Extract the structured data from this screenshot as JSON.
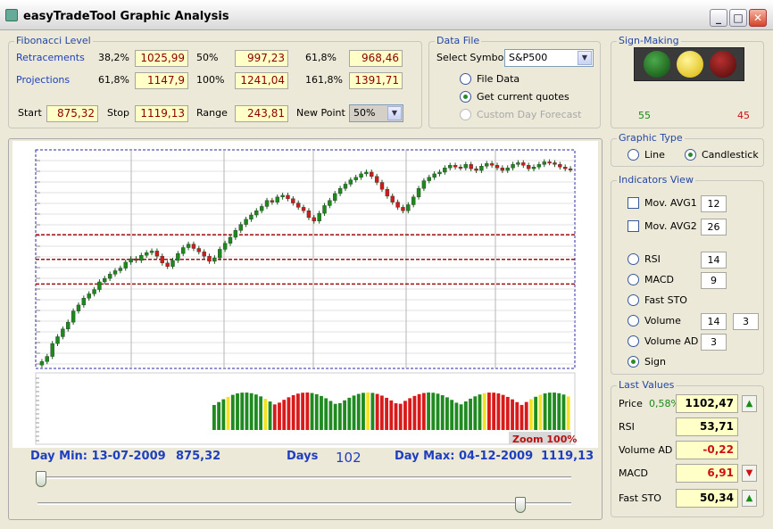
{
  "window": {
    "title": "easyTradeTool Graphic Analysis",
    "buttons": {
      "minimize": "_",
      "maximize": "□",
      "close": "✕"
    }
  },
  "fibonacci": {
    "group_label": "Fibonacci Level",
    "retracements_label": "Retracements",
    "projections_label": "Projections",
    "retr": [
      {
        "pct": "38,2%",
        "val": "1025,99"
      },
      {
        "pct": "50%",
        "val": "997,23"
      },
      {
        "pct": "61,8%",
        "val": "968,46"
      }
    ],
    "proj": [
      {
        "pct": "61,8%",
        "val": "1147,9"
      },
      {
        "pct": "100%",
        "val": "1241,04"
      },
      {
        "pct": "161,8%",
        "val": "1391,71"
      }
    ],
    "start_label": "Start",
    "start_val": "875,32",
    "stop_label": "Stop",
    "stop_val": "1119,13",
    "range_label": "Range",
    "range_val": "243,81",
    "newpoint_label": "New Point",
    "newpoint_val": "50%"
  },
  "datafile": {
    "group_label": "Data File",
    "symbol_label": "Select Symbol",
    "symbol_val": "S&P500",
    "opt_file": "File Data",
    "opt_current": "Get current quotes",
    "opt_custom": "Custom Day Forecast"
  },
  "sign": {
    "group_label": "Sign-Making",
    "left": "55",
    "right": "45",
    "colors": {
      "green": "#1f6b1f",
      "yellow": "#e6cf1c",
      "red": "#7a1010"
    }
  },
  "graphic_type": {
    "group_label": "Graphic Type",
    "line": "Line",
    "candle": "Candlestick"
  },
  "indicators": {
    "group_label": "Indicators View",
    "mov1": "Mov. AVG1",
    "mov1_val": "12",
    "mov2": "Mov. AVG2",
    "mov2_val": "26",
    "rsi": "RSI",
    "rsi_val": "14",
    "macd": "MACD",
    "macd_val": "9",
    "fast": "Fast STO",
    "volume": "Volume",
    "volume_val": "14",
    "volume_val2": "3",
    "volad": "Volume AD",
    "volad_val": "3",
    "sign": "Sign"
  },
  "last_values": {
    "group_label": "Last Values",
    "price_label": "Price",
    "price_pct": "0,58%",
    "price_val": "1102,47",
    "rsi_label": "RSI",
    "rsi_val": "53,71",
    "volad_label": "Volume AD",
    "volad_val": "-0,22",
    "macd_label": "MACD",
    "macd_val": "6,91",
    "fast_label": "Fast STO",
    "fast_val": "50,34",
    "arrows": {
      "up": "▲",
      "down": "▼"
    }
  },
  "chart": {
    "zoom_label": "Zoom 100%",
    "day_min_label": "Day Min: 13-07-2009",
    "day_min_val": "875,32",
    "days_label": "Days",
    "days_val": "102",
    "day_max_label": "Day Max: 04-12-2009",
    "day_max_val": "1119,13"
  },
  "chart_data": {
    "type": "candlestick",
    "close": [
      878,
      884,
      899,
      907,
      916,
      924,
      937,
      944,
      952,
      957,
      962,
      971,
      975,
      980,
      984,
      987,
      994,
      998,
      996,
      1002,
      1005,
      1007,
      1001,
      993,
      989,
      996,
      1004,
      1011,
      1015,
      1010,
      1006,
      1001,
      995,
      999,
      1009,
      1016,
      1023,
      1031,
      1038,
      1044,
      1049,
      1054,
      1059,
      1066,
      1064,
      1070,
      1072,
      1068,
      1063,
      1058,
      1054,
      1046,
      1042,
      1051,
      1060,
      1066,
      1074,
      1080,
      1085,
      1090,
      1093,
      1097,
      1099,
      1094,
      1087,
      1079,
      1071,
      1064,
      1058,
      1054,
      1061,
      1070,
      1080,
      1089,
      1093,
      1097,
      1099,
      1104,
      1107,
      1105,
      1104,
      1108,
      1103,
      1101,
      1106,
      1109,
      1107,
      1104,
      1101,
      1104,
      1108,
      1110,
      1107,
      1103,
      1105,
      1108,
      1111,
      1110,
      1108,
      1105,
      1103,
      1102
    ],
    "volume_colors": [
      "g",
      "g",
      "g",
      "y",
      "g",
      "g",
      "g",
      "g",
      "g",
      "g",
      "g",
      "y",
      "g",
      "r",
      "r",
      "r",
      "r",
      "r",
      "r",
      "r",
      "r",
      "g",
      "g",
      "g",
      "g",
      "g",
      "g",
      "g",
      "g",
      "g",
      "g",
      "g",
      "g",
      "y",
      "g",
      "r",
      "r",
      "r",
      "r",
      "r",
      "r",
      "r",
      "r",
      "r",
      "r",
      "r",
      "g",
      "g",
      "g",
      "g",
      "g",
      "g",
      "g",
      "g",
      "g",
      "g",
      "g",
      "g",
      "y",
      "r",
      "r",
      "r",
      "r",
      "r",
      "r",
      "r",
      "r",
      "r",
      "y",
      "g",
      "y",
      "g",
      "g",
      "g",
      "g",
      "g",
      "y"
    ],
    "fib_levels": [
      1025.99,
      997.23,
      968.46
    ],
    "ylim": [
      870,
      1125
    ]
  }
}
